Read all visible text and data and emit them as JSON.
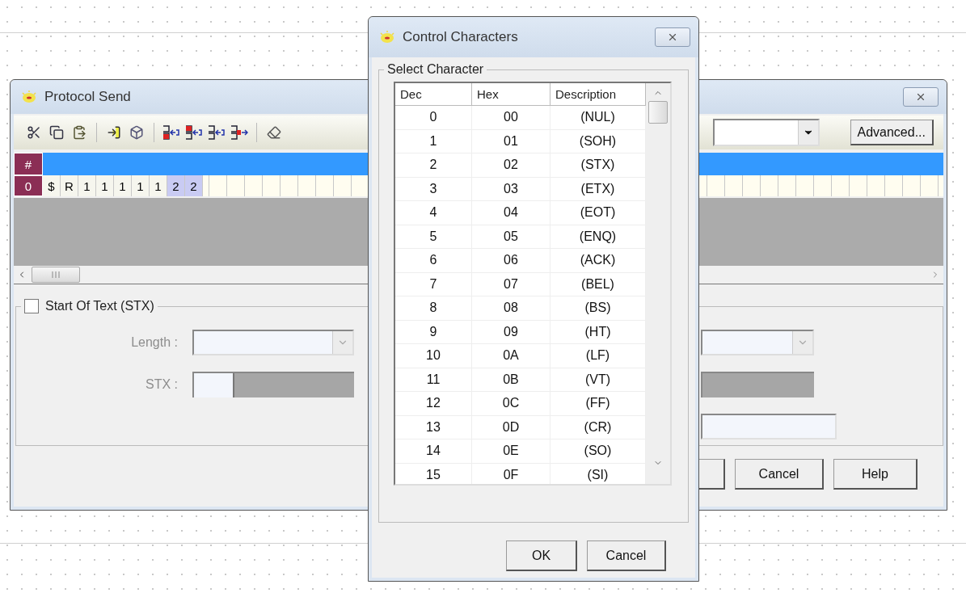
{
  "protocol_window": {
    "title": "Protocol Send",
    "advanced_button": "Advanced...",
    "grid": {
      "header": "#",
      "rows": [
        {
          "label": "0",
          "cells": [
            {
              "text": "$",
              "kind": "plain"
            },
            {
              "text": "R",
              "kind": "plain"
            },
            {
              "text": "1",
              "kind": "plain"
            },
            {
              "text": "1",
              "kind": "plain"
            },
            {
              "text": "1",
              "kind": "plain"
            },
            {
              "text": "1",
              "kind": "plain"
            },
            {
              "text": "1",
              "kind": "plain"
            },
            {
              "text": "2",
              "kind": "marked"
            },
            {
              "text": "2",
              "kind": "marked"
            }
          ]
        }
      ]
    },
    "stx_group": {
      "checkbox": {
        "label": "Start Of Text (STX)",
        "checked": false
      },
      "disabled": true,
      "length_label": "Length :",
      "stx_label": "STX :"
    },
    "buttons": [
      "Cancel",
      "Help"
    ]
  },
  "dialog": {
    "title": "Control Characters",
    "group_label": "Select Character",
    "columns": [
      "Dec",
      "Hex",
      "Description"
    ],
    "rows": [
      {
        "dec": "0",
        "hex": "00",
        "description": "(NUL)"
      },
      {
        "dec": "1",
        "hex": "01",
        "description": "(SOH)"
      },
      {
        "dec": "2",
        "hex": "02",
        "description": "(STX)"
      },
      {
        "dec": "3",
        "hex": "03",
        "description": "(ETX)"
      },
      {
        "dec": "4",
        "hex": "04",
        "description": "(EOT)"
      },
      {
        "dec": "5",
        "hex": "05",
        "description": "(ENQ)"
      },
      {
        "dec": "6",
        "hex": "06",
        "description": "(ACK)"
      },
      {
        "dec": "7",
        "hex": "07",
        "description": "(BEL)"
      },
      {
        "dec": "8",
        "hex": "08",
        "description": "(BS)"
      },
      {
        "dec": "9",
        "hex": "09",
        "description": "(HT)"
      },
      {
        "dec": "10",
        "hex": "0A",
        "description": "(LF)"
      },
      {
        "dec": "11",
        "hex": "0B",
        "description": "(VT)"
      },
      {
        "dec": "12",
        "hex": "0C",
        "description": "(FF)"
      },
      {
        "dec": "13",
        "hex": "0D",
        "description": "(CR)"
      },
      {
        "dec": "14",
        "hex": "0E",
        "description": "(SO)"
      },
      {
        "dec": "15",
        "hex": "0F",
        "description": "(SI)"
      }
    ],
    "buttons": [
      "OK",
      "Cancel"
    ]
  }
}
